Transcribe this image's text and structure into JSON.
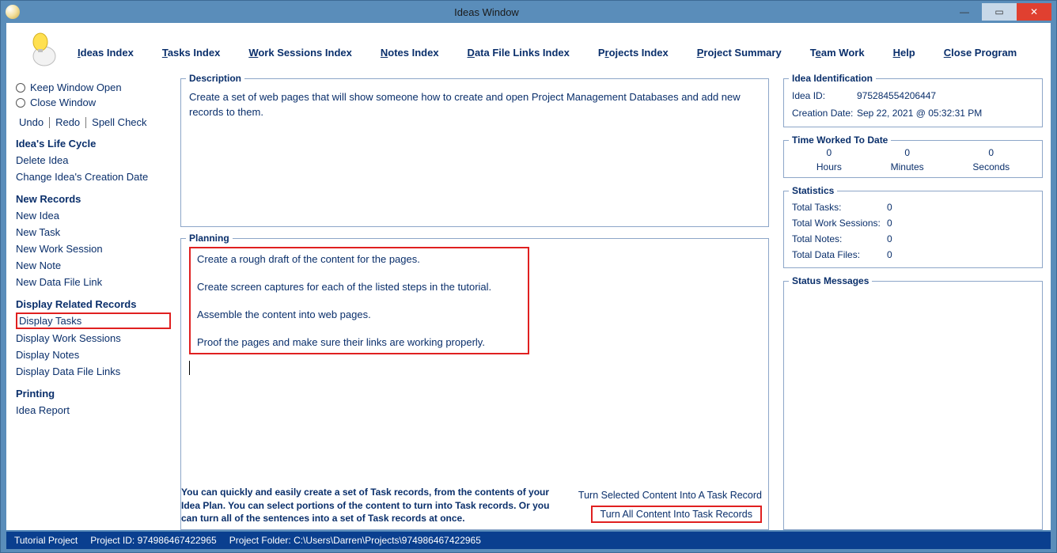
{
  "window": {
    "title": "Ideas Window"
  },
  "menu": {
    "ideas_index": "Ideas Index",
    "tasks_index": "Tasks Index",
    "work_sessions_index": "Work Sessions Index",
    "notes_index": "Notes Index",
    "data_file_links_index": "Data File Links Index",
    "projects_index": "Projects Index",
    "project_summary": "Project Summary",
    "team_work": "Team Work",
    "help": "Help",
    "close_program": "Close Program"
  },
  "sidebar": {
    "keep_open": "Keep Window Open",
    "close_window": "Close Window",
    "undo": "Undo",
    "redo": "Redo",
    "spell": "Spell Check",
    "life_head": "Idea's Life Cycle",
    "delete_idea": "Delete Idea",
    "change_date": "Change Idea's Creation Date",
    "new_head": "New Records",
    "new_idea": "New Idea",
    "new_task": "New Task",
    "new_ws": "New Work Session",
    "new_note": "New Note",
    "new_dfl": "New Data File Link",
    "disp_head": "Display Related Records",
    "disp_tasks": "Display Tasks",
    "disp_ws": "Display Work Sessions",
    "disp_notes": "Display Notes",
    "disp_dfl": "Display Data File Links",
    "print_head": "Printing",
    "idea_report": "Idea Report"
  },
  "description": {
    "legend": "Description",
    "text": "Create a set of web pages that will show someone how to create and open Project Management Databases and add new records to them."
  },
  "planning": {
    "legend": "Planning",
    "lines": [
      "Create a rough draft of the content for the pages.",
      "Create screen captures for each of the listed steps in the tutorial.",
      "Assemble the content into web pages.",
      "Proof the pages and make sure their links are working properly."
    ],
    "footer_text": "You can quickly and easily create a set of Task records, from the contents of your Idea Plan. You can select portions of the content to turn into Task records. Or you can turn all of the sentences into a set of Task records at once.",
    "turn_selected": "Turn Selected Content Into A Task Record",
    "turn_all": "Turn All Content Into Task Records"
  },
  "ident": {
    "legend": "Idea Identification",
    "id_label": "Idea ID:",
    "id_value": "975284554206447",
    "date_label": "Creation Date:",
    "date_value": "Sep  22, 2021 @ 05:32:31 PM"
  },
  "time": {
    "legend": "Time Worked To Date",
    "hours_label": "Hours",
    "minutes_label": "Minutes",
    "seconds_label": "Seconds",
    "hours": "0",
    "minutes": "0",
    "seconds": "0"
  },
  "stats": {
    "legend": "Statistics",
    "tasks_label": "Total Tasks:",
    "ws_label": "Total Work Sessions:",
    "notes_label": "Total Notes:",
    "df_label": "Total Data Files:",
    "tasks": "0",
    "ws": "0",
    "notes": "0",
    "df": "0"
  },
  "status": {
    "legend": "Status Messages"
  },
  "statusbar": {
    "proj_name": "Tutorial Project",
    "proj_id": "Project ID: 974986467422965",
    "proj_folder": "Project Folder: C:\\Users\\Darren\\Projects\\974986467422965"
  }
}
